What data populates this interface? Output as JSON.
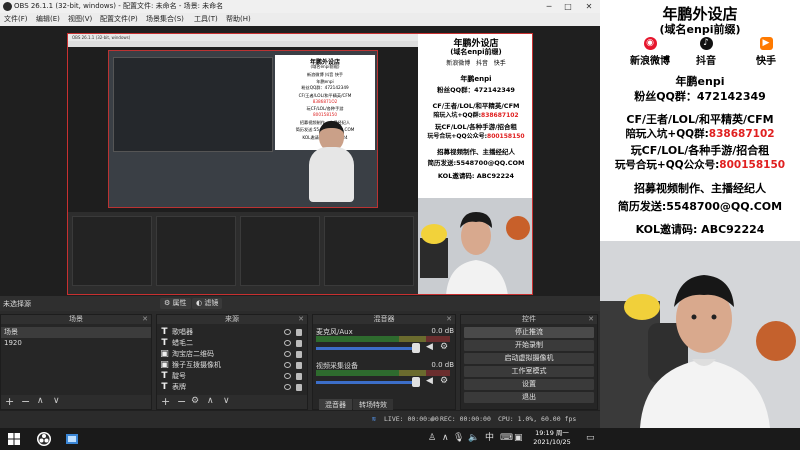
{
  "window": {
    "title": "OBS 26.1.1 (32-bit, windows) - 配置文件: 未命名 - 场景: 未命名",
    "minimize": "─",
    "maximize": "□",
    "close": "✕"
  },
  "menu": [
    "文件(F)",
    "编辑(E)",
    "视图(V)",
    "配置文件(P)",
    "场景集合(S)",
    "工具(T)",
    "帮助(H)"
  ],
  "nested_obs": {
    "title": "OBS 26.1.1 (32-bit, windows)",
    "mini_ad": [
      "年鹏外设店",
      "(域名enpi前缀)",
      "新浪微博 抖音 快手",
      "年鹏enpi",
      "粉丝QQ群：472142349",
      "CF/王者/LOL/和平精英/CFM",
      "8386871O2",
      "玩CF/LOL/各种手游",
      "800158150",
      "招募视频制作、主播经纪人",
      "简历发送:5548700@QQ.COM",
      "KOL邀请码: ABC92224"
    ]
  },
  "canvas_ad": {
    "shop_name": "年鹏外设店",
    "shop_domain": "(域名enpi前缀)",
    "social": [
      "新浪微博",
      "抖音",
      "快手"
    ],
    "handle": "年鹏enpi",
    "fan_group": "粉丝QQ群：472142349",
    "games": "CF/王者/LOL/和平精英/CFM",
    "invite": "陪玩入坑+QQ群:",
    "invite_num": "838687102",
    "play": "玩CF/LOL/各种手游/招合租",
    "play2": "玩号合玩+QQ公众号:",
    "play_num": "800158150",
    "recruit": "招募视频制作、主播经纪人",
    "resume": "简历发送:5548700@QQ.COM",
    "kol": "KOL邀请码: ABC92224"
  },
  "filterbar": {
    "label": "未选择源",
    "properties": "属性",
    "filters": "滤镜"
  },
  "scenes": {
    "title": "场景",
    "items": [
      "场景",
      "1920"
    ]
  },
  "sources": {
    "title": "来源",
    "items": [
      {
        "icon": "T",
        "name": "歌唱器"
      },
      {
        "icon": "T",
        "name": "蜡毛二"
      },
      {
        "icon": "▣",
        "name": "淘宝店二维码"
      },
      {
        "icon": "▣",
        "name": "猴子互拨摄像机"
      },
      {
        "icon": "T",
        "name": "靛号"
      },
      {
        "icon": "T",
        "name": "表牌"
      }
    ]
  },
  "mixer": {
    "title": "混音器",
    "channels": [
      {
        "name": "麦克风/Aux",
        "db": "0.0 dB"
      },
      {
        "name": "视频采集设备",
        "db": "0.0 dB"
      }
    ],
    "tab_mixer": "混音器",
    "tab_transitions": "转场特效"
  },
  "controls": {
    "title": "控件",
    "buttons": [
      "停止推流",
      "开始录制",
      "启动虚拟摄像机",
      "工作室模式",
      "设置",
      "退出"
    ]
  },
  "status": {
    "live": "LIVE: 00:00:00",
    "rec": "REC: 00:00:00",
    "cpu": "CPU: 1.0%, 60.00 fps"
  },
  "right_ad": {
    "shop_name": "年鹏外设店",
    "shop_domain": "(域名enpi前缀)",
    "social": [
      {
        "label": "新浪微博",
        "icon": "weibo-icon",
        "color": "#e6162d"
      },
      {
        "label": "抖音",
        "icon": "tiktok-icon",
        "color": "#111111"
      },
      {
        "label": "快手",
        "icon": "kuaishou-icon",
        "color": "#ff7a00"
      }
    ],
    "handle": "年鹏enpi",
    "fan_group": "粉丝QQ群：472142349",
    "games": "CF/王者/LOL/和平精英/CFM",
    "invite": "陪玩入坑+QQ群:",
    "invite_num": "838687102",
    "play": "玩CF/LOL/各种手游/招合租",
    "play2": "玩号合玩+QQ公众号:",
    "play_num": "800158150",
    "recruit": "招募视频制作、主播经纪人",
    "resume": "简历发送:5548700@QQ.COM",
    "kol": "KOL邀请码: ABC92224"
  },
  "taskbar": {
    "time": "19:19 周一",
    "date": "2021/10/25",
    "ime": "中",
    "accent": "#c83030"
  }
}
